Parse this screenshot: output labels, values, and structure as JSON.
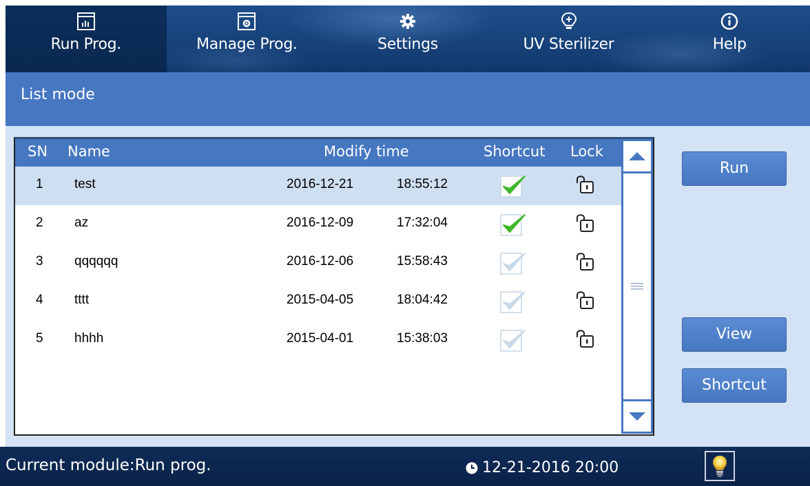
{
  "nav": {
    "tabs": [
      {
        "label": "Run Prog.",
        "icon": "program-list-icon",
        "active": true
      },
      {
        "label": "Manage Prog.",
        "icon": "manage-program-icon",
        "active": false
      },
      {
        "label": "Settings",
        "icon": "gear-icon",
        "active": false
      },
      {
        "label": "UV Sterilizer",
        "icon": "uv-lamp-icon",
        "active": false
      },
      {
        "label": "Help",
        "icon": "info-icon",
        "active": false
      }
    ]
  },
  "subheader": {
    "title": "List mode"
  },
  "table": {
    "headers": {
      "sn": "SN",
      "name": "Name",
      "modify_time": "Modify time",
      "shortcut": "Shortcut",
      "lock": "Lock"
    },
    "rows": [
      {
        "sn": "1",
        "name": "test",
        "date": "2016-12-21",
        "time": "18:55:12",
        "shortcut": true,
        "locked": false,
        "selected": true
      },
      {
        "sn": "2",
        "name": "az",
        "date": "2016-12-09",
        "time": "17:32:04",
        "shortcut": true,
        "locked": false,
        "selected": false
      },
      {
        "sn": "3",
        "name": "qqqqqq",
        "date": "2016-12-06",
        "time": "15:58:43",
        "shortcut": false,
        "locked": false,
        "selected": false
      },
      {
        "sn": "4",
        "name": "tttt",
        "date": "2015-04-05",
        "time": "18:04:42",
        "shortcut": false,
        "locked": false,
        "selected": false
      },
      {
        "sn": "5",
        "name": "hhhh",
        "date": "2015-04-01",
        "time": "15:38:03",
        "shortcut": false,
        "locked": false,
        "selected": false
      }
    ]
  },
  "buttons": {
    "run": "Run",
    "view": "View",
    "shortcut": "Shortcut"
  },
  "status": {
    "module": "Current module:Run prog.",
    "datetime": "12-21-2016 20:00"
  },
  "colors": {
    "accent": "#4677c1",
    "check_active": "#3fb829",
    "check_inactive": "#c9d9e8"
  }
}
